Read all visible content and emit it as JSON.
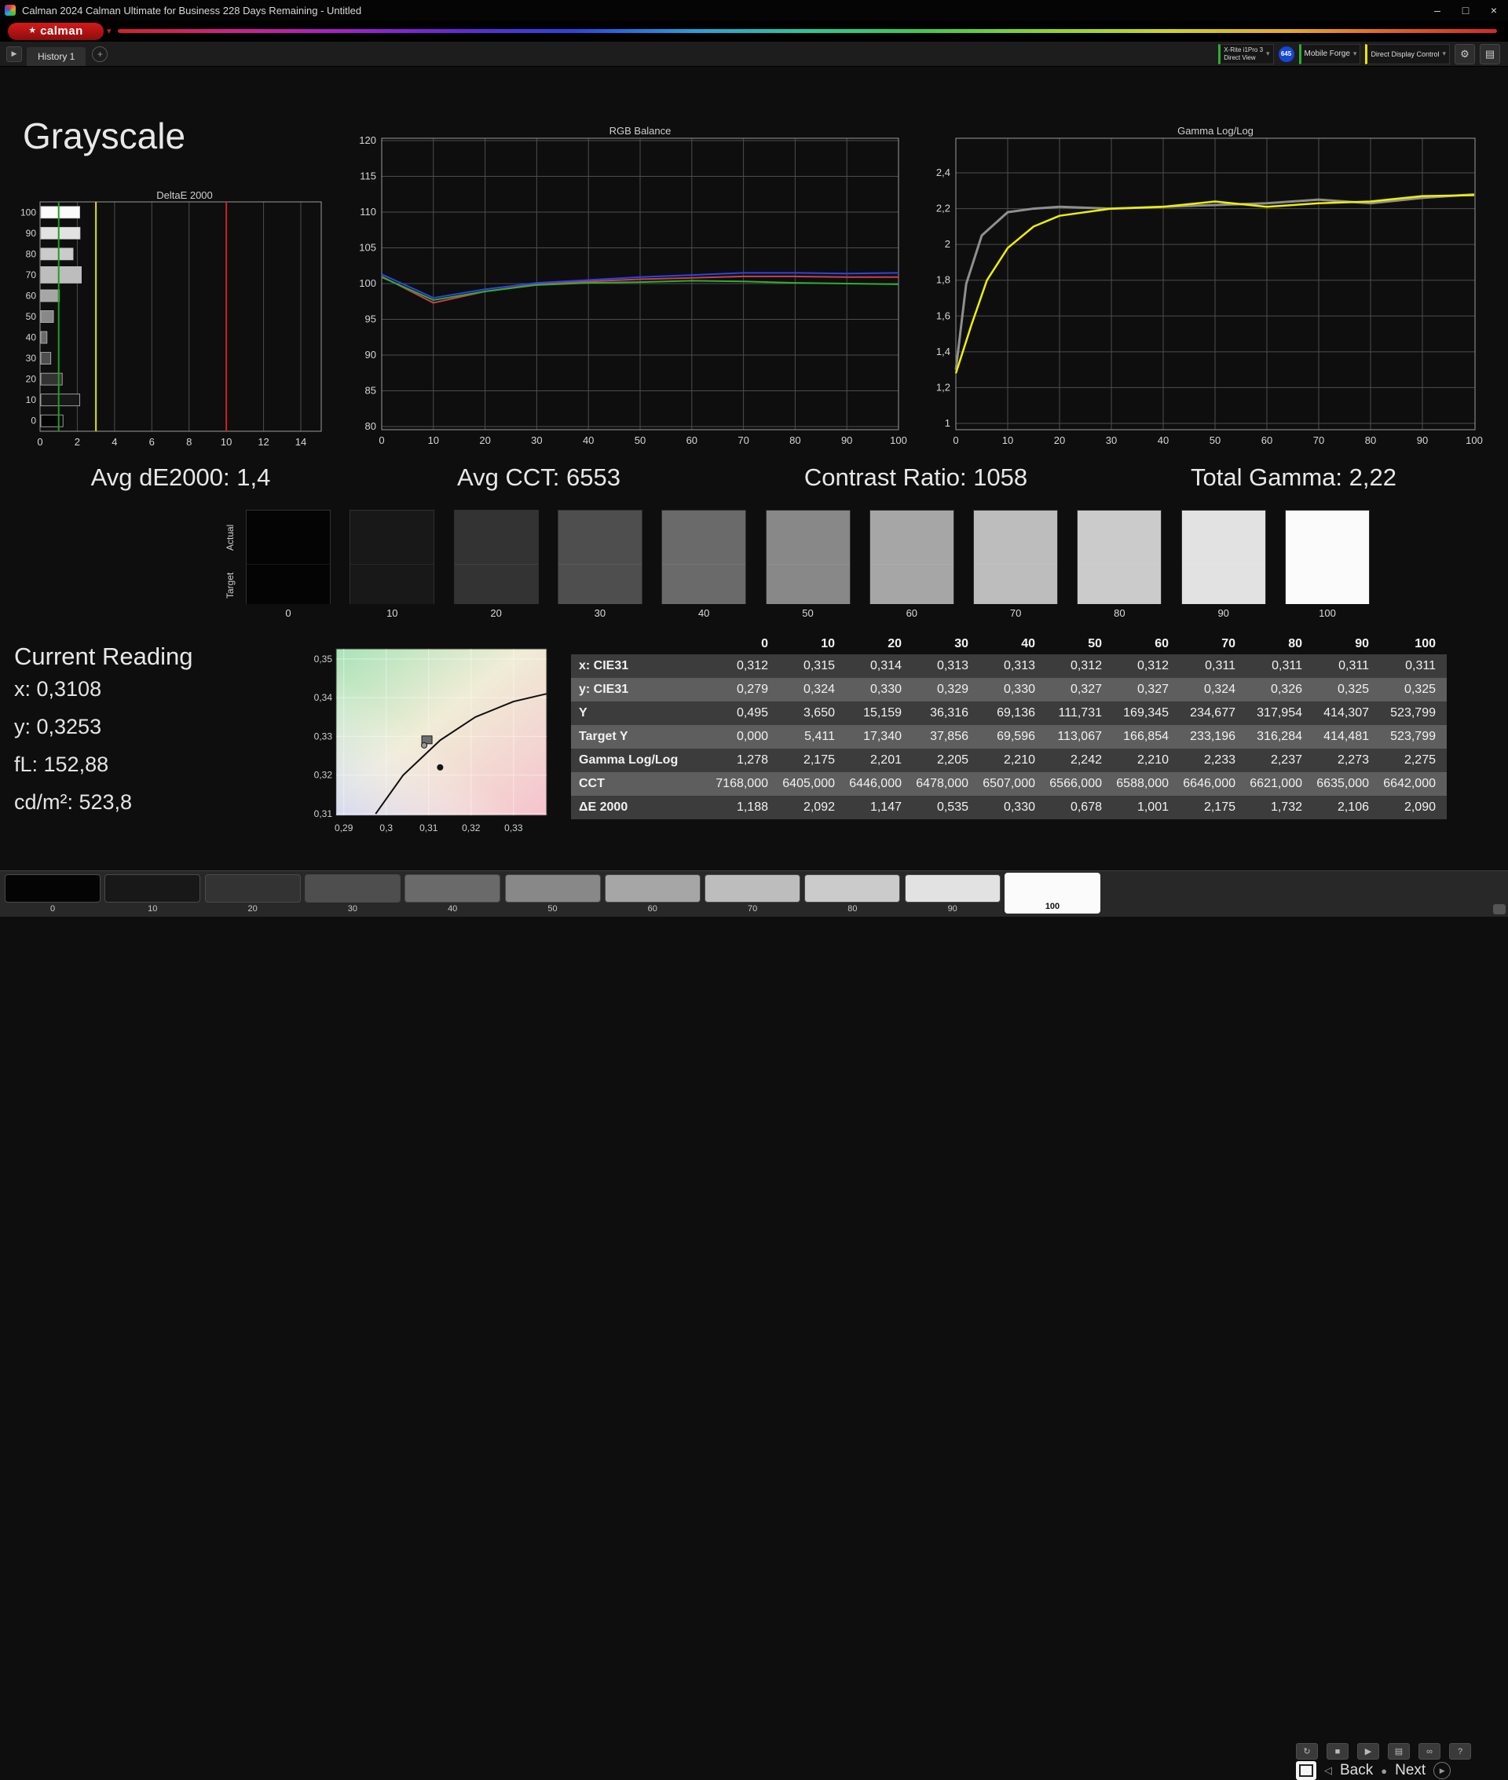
{
  "window": {
    "title": "Calman 2024 Calman Ultimate for Business 228 Days Remaining  - Untitled"
  },
  "icons": {
    "logo_star": "★",
    "dropdown_arrow": "▾",
    "history_prev": "▶",
    "add_tab": "+",
    "gear": "⚙",
    "panels": "▤",
    "minimize": "–",
    "maximize": "□",
    "close": "×",
    "repeat": "↻",
    "stop": "■",
    "play": "▶",
    "save": "▤",
    "loop": "∞",
    "help": "?",
    "horn": "◁",
    "record": "●",
    "play_circle": "▶"
  },
  "brand": {
    "logo": "calman"
  },
  "toolbar": {
    "history_tab": "History 1",
    "meter_device": {
      "line1": "X-Rite i1Pro 3",
      "line2": "Direct View"
    },
    "badge": "645",
    "pattern_source": "Mobile Forge",
    "display_control": "Direct Display Control"
  },
  "page": {
    "title": "Grayscale"
  },
  "stats": {
    "avg_de": "Avg dE2000: 1,4",
    "avg_cct": "Avg CCT: 6553",
    "contrast": "Contrast Ratio: 1058",
    "total_gamma": "Total Gamma: 2,22"
  },
  "patch_strip": {
    "row_labels": [
      "Actual",
      "Target"
    ],
    "levels": [
      "0",
      "10",
      "20",
      "30",
      "40",
      "50",
      "60",
      "70",
      "80",
      "90",
      "100"
    ],
    "colors": [
      "#040404",
      "#181818",
      "#333333",
      "#4e4e4e",
      "#6a6a6a",
      "#888888",
      "#a6a6a6",
      "#bdbdbd",
      "#cbcbcb",
      "#e2e2e2",
      "#fbfbfb"
    ]
  },
  "current_reading": {
    "title": "Current Reading",
    "lines": [
      "x: 0,3108",
      "y: 0,3253",
      "fL: 152,88",
      "cd/m²: 523,8"
    ]
  },
  "table": {
    "header": [
      "",
      "0",
      "10",
      "20",
      "30",
      "40",
      "50",
      "60",
      "70",
      "80",
      "90",
      "100"
    ],
    "rows": [
      {
        "label": "x: CIE31",
        "values": [
          "0,312",
          "0,315",
          "0,314",
          "0,313",
          "0,313",
          "0,312",
          "0,312",
          "0,311",
          "0,311",
          "0,311",
          "0,311"
        ]
      },
      {
        "label": "y: CIE31",
        "values": [
          "0,279",
          "0,324",
          "0,330",
          "0,329",
          "0,330",
          "0,327",
          "0,327",
          "0,324",
          "0,326",
          "0,325",
          "0,325"
        ]
      },
      {
        "label": "Y",
        "values": [
          "0,495",
          "3,650",
          "15,159",
          "36,316",
          "69,136",
          "111,731",
          "169,345",
          "234,677",
          "317,954",
          "414,307",
          "523,799"
        ]
      },
      {
        "label": "Target Y",
        "values": [
          "0,000",
          "5,411",
          "17,340",
          "37,856",
          "69,596",
          "113,067",
          "166,854",
          "233,196",
          "316,284",
          "414,481",
          "523,799"
        ]
      },
      {
        "label": "Gamma Log/Log",
        "values": [
          "1,278",
          "2,175",
          "2,201",
          "2,205",
          "2,210",
          "2,242",
          "2,210",
          "2,233",
          "2,237",
          "2,273",
          "2,275"
        ]
      },
      {
        "label": "CCT",
        "values": [
          "7168,000",
          "6405,000",
          "6446,000",
          "6478,000",
          "6507,000",
          "6566,000",
          "6588,000",
          "6646,000",
          "6621,000",
          "6635,000",
          "6642,000"
        ]
      },
      {
        "label": "ΔE 2000",
        "values": [
          "1,188",
          "2,092",
          "1,147",
          "0,535",
          "0,330",
          "0,678",
          "1,001",
          "2,175",
          "1,732",
          "2,106",
          "2,090"
        ]
      }
    ]
  },
  "bottom_bar": {
    "levels": [
      "0",
      "10",
      "20",
      "30",
      "40",
      "50",
      "60",
      "70",
      "80",
      "90",
      "100"
    ],
    "colors": [
      "#040404",
      "#181818",
      "#333333",
      "#4e4e4e",
      "#6a6a6a",
      "#888888",
      "#a6a6a6",
      "#bdbdbd",
      "#cbcbcb",
      "#e2e2e2",
      "#fbfbfb"
    ],
    "selected": "100",
    "transport": [
      "repeat",
      "stop",
      "play",
      "save",
      "loop",
      "help"
    ],
    "back": "Back",
    "next": "Next"
  },
  "chart_data": [
    {
      "id": "deltae",
      "type": "bar",
      "orientation": "horizontal",
      "title": "DeltaE 2000",
      "categories": [
        100,
        90,
        80,
        70,
        60,
        50,
        40,
        30,
        20,
        10,
        0
      ],
      "values": [
        2.09,
        2.106,
        1.732,
        2.175,
        1.001,
        0.678,
        0.33,
        0.535,
        1.147,
        2.092,
        1.188
      ],
      "highlight": 70,
      "xlim": [
        0,
        15.1
      ],
      "xticks": [
        0,
        2,
        4,
        6,
        8,
        10,
        12,
        14
      ],
      "ref_lines": [
        {
          "value": 1,
          "color": "#1f9e1f",
          "name": "avg-line"
        },
        {
          "value": 3,
          "color": "#e4e400",
          "name": "warn-threshold"
        },
        {
          "value": 10,
          "color": "#d22020",
          "name": "fail-threshold"
        }
      ]
    },
    {
      "id": "rgb",
      "type": "line",
      "title": "RGB Balance",
      "x": [
        0,
        10,
        20,
        30,
        40,
        50,
        60,
        70,
        80,
        90,
        100
      ],
      "xticks": [
        0,
        10,
        20,
        30,
        40,
        50,
        60,
        70,
        80,
        90,
        100
      ],
      "yticks": [
        120,
        115,
        110,
        105,
        100,
        95,
        90,
        85,
        80
      ],
      "ylim": [
        80,
        120
      ],
      "series": [
        {
          "name": "red",
          "color": "#cf3d4e",
          "values": [
            101.0,
            97.3,
            98.9,
            99.9,
            100.3,
            100.6,
            100.8,
            101.0,
            101.0,
            100.9,
            100.9
          ]
        },
        {
          "name": "green",
          "color": "#2fae2f",
          "values": [
            100.9,
            97.7,
            98.9,
            99.8,
            100.1,
            100.2,
            100.4,
            100.3,
            100.1,
            100.0,
            99.9
          ]
        },
        {
          "name": "blue",
          "color": "#2b46e8",
          "values": [
            101.3,
            98.0,
            99.2,
            100.1,
            100.5,
            100.9,
            101.2,
            101.5,
            101.5,
            101.4,
            101.5
          ]
        }
      ]
    },
    {
      "id": "gamma",
      "type": "line",
      "title": "Gamma Log/Log",
      "xticks": [
        0,
        10,
        20,
        30,
        40,
        50,
        60,
        70,
        80,
        90,
        100
      ],
      "yticks": [
        {
          "v": 2.4,
          "label": "2,4"
        },
        {
          "v": 2.2,
          "label": "2,2"
        },
        {
          "v": 2.0,
          "label": "2"
        },
        {
          "v": 1.8,
          "label": "1,8"
        },
        {
          "v": 1.6,
          "label": "1,6"
        },
        {
          "v": 1.4,
          "label": "1,4"
        },
        {
          "v": 1.2,
          "label": "1,2"
        },
        {
          "v": 1.0,
          "label": "1"
        }
      ],
      "ylim": [
        0.96,
        2.59
      ],
      "series": [
        {
          "name": "target",
          "color": "#8f8f8f",
          "width": 3,
          "x": [
            0,
            2,
            5,
            10,
            15,
            20,
            30,
            40,
            50,
            60,
            70,
            80,
            90,
            100
          ],
          "values": [
            1.3,
            1.78,
            2.05,
            2.18,
            2.2,
            2.21,
            2.2,
            2.21,
            2.22,
            2.23,
            2.25,
            2.23,
            2.26,
            2.28
          ]
        },
        {
          "name": "measured",
          "color": "#efef00",
          "width": 2.5,
          "x": [
            0,
            3,
            6,
            10,
            15,
            20,
            30,
            40,
            50,
            60,
            70,
            80,
            90,
            100
          ],
          "values": [
            1.28,
            1.55,
            1.8,
            1.98,
            2.1,
            2.16,
            2.2,
            2.21,
            2.24,
            2.21,
            2.23,
            2.24,
            2.27,
            2.275
          ]
        }
      ]
    },
    {
      "id": "cie",
      "type": "scatter",
      "title": "CIE 1931 chromaticity detail",
      "xticks": [
        {
          "v": 0.29,
          "label": "0,29"
        },
        {
          "v": 0.3,
          "label": "0,3"
        },
        {
          "v": 0.31,
          "label": "0,31"
        },
        {
          "v": 0.32,
          "label": "0,32"
        },
        {
          "v": 0.33,
          "label": "0,33"
        }
      ],
      "yticks": [
        {
          "v": 0.35,
          "label": "0,35"
        },
        {
          "v": 0.34,
          "label": "0,34"
        },
        {
          "v": 0.33,
          "label": "0,33"
        },
        {
          "v": 0.32,
          "label": "0,32"
        },
        {
          "v": 0.31,
          "label": "0,31"
        }
      ],
      "locus": [
        [
          0.2975,
          0.31
        ],
        [
          0.304,
          0.32
        ],
        [
          0.3127,
          0.329
        ],
        [
          0.321,
          0.335
        ],
        [
          0.33,
          0.339
        ],
        [
          0.3378,
          0.341
        ]
      ],
      "points": [
        {
          "x": 0.3095,
          "y": 0.3285,
          "kind": "meter"
        },
        {
          "x": 0.3127,
          "y": 0.322,
          "kind": "dot"
        }
      ]
    }
  ]
}
